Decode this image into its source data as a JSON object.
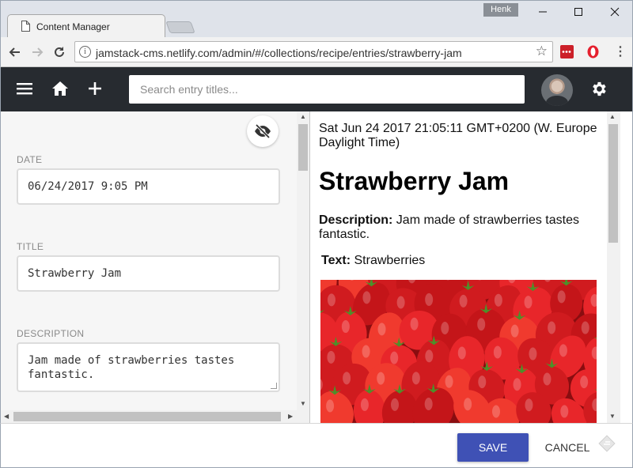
{
  "browser": {
    "tab_title": "Content Manager",
    "user_badge": "Henk",
    "url": "jamstack-cms.netlify.com/admin/#/collections/recipe/entries/strawberry-jam"
  },
  "appbar": {
    "search_placeholder": "Search entry titles..."
  },
  "editor": {
    "fields": {
      "date": {
        "label": "DATE",
        "value": "06/24/2017 9:05 PM"
      },
      "title": {
        "label": "TITLE",
        "value": "Strawberry Jam"
      },
      "description": {
        "label": "DESCRIPTION",
        "value": "Jam made of strawberries tastes\nfantastic."
      }
    }
  },
  "preview": {
    "date": "Sat Jun 24 2017 21:05:11 GMT+0200 (W. Europe Daylight Time)",
    "title": "Strawberry Jam",
    "description_label": "Description:",
    "description": "Jam made of strawberries tastes fantastic.",
    "text_label": "Text:",
    "text": "Strawberries"
  },
  "footer": {
    "save_label": "SAVE",
    "cancel_label": "CANCEL"
  },
  "colors": {
    "appbar": "#272b30",
    "accent": "#3f51b5",
    "field_border": "#dcdcdc"
  }
}
